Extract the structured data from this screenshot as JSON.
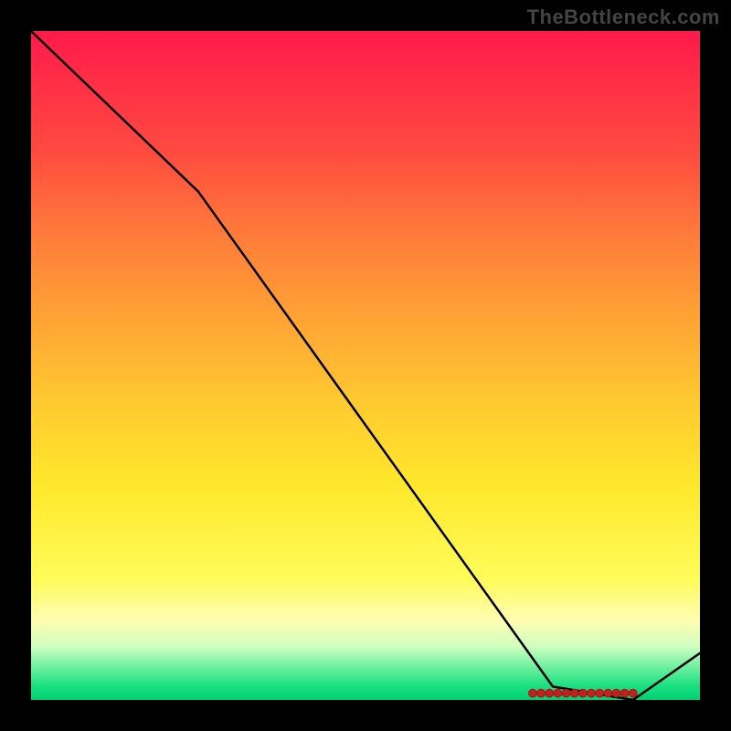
{
  "watermark": "TheBottleneck.com",
  "chart_data": {
    "type": "line",
    "title": "",
    "xlabel": "",
    "ylabel": "",
    "xlim": [
      0,
      100
    ],
    "ylim": [
      0,
      100
    ],
    "grid": false,
    "legend": false,
    "series": [
      {
        "name": "bottleneck-curve",
        "x": [
          0,
          25,
          78,
          90,
          100
        ],
        "values": [
          100,
          76,
          2,
          0,
          7
        ]
      }
    ],
    "markers_x_range": [
      75,
      90
    ],
    "markers_y": 1
  }
}
